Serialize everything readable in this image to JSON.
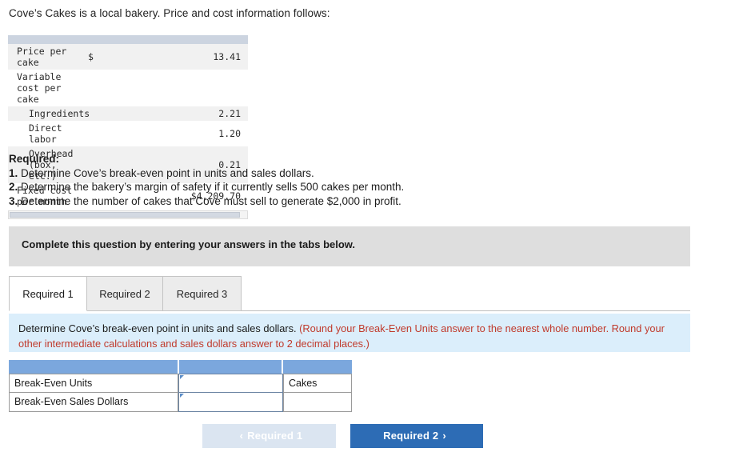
{
  "intro": "Cove’s Cakes is a local bakery. Price and cost information follows:",
  "fact_table": {
    "rows": [
      {
        "label": "Price per cake",
        "indent": false,
        "currency": "$",
        "value": "13.41",
        "shaded": true
      },
      {
        "label": "Variable cost per cake",
        "indent": false,
        "currency": "",
        "value": "",
        "shaded": false
      },
      {
        "label": "Ingredients",
        "indent": true,
        "currency": "",
        "value": "2.21",
        "shaded": true
      },
      {
        "label": "Direct labor",
        "indent": true,
        "currency": "",
        "value": "1.20",
        "shaded": false
      },
      {
        "label": "Overhead (box, etc.)",
        "indent": true,
        "currency": "",
        "value": "0.21",
        "shaded": true
      },
      {
        "label": "Fixed cost per month",
        "indent": false,
        "currency": "",
        "value": "$4,209.70",
        "shaded": false
      }
    ]
  },
  "required": {
    "heading": "Required:",
    "items": [
      {
        "num": "1.",
        "text": "Determine Cove’s break-even point in units and sales dollars."
      },
      {
        "num": "2.",
        "text": "Determine the bakery’s margin of safety if it currently sells 500 cakes per month."
      },
      {
        "num": "3.",
        "text": "Determine the number of cakes that Cove must sell to generate $2,000 in profit."
      }
    ]
  },
  "banner": {
    "text": "Complete this question by entering your answers in the tabs below."
  },
  "tabs": [
    {
      "label": "Required 1",
      "active": true
    },
    {
      "label": "Required 2",
      "active": false
    },
    {
      "label": "Required 3",
      "active": false
    }
  ],
  "instruction": {
    "black": "Determine Cove’s break-even point in units and sales dollars.",
    "red": "(Round your Break-Even Units answer to the nearest whole number. Round your other intermediate calculations and sales dollars answer to 2 decimal places.)"
  },
  "answer_table": {
    "header_cells": [
      "",
      "",
      ""
    ],
    "rows": [
      {
        "label": "Break-Even Units",
        "value": "",
        "unit": "Cakes"
      },
      {
        "label": "Break-Even Sales Dollars",
        "value": "",
        "unit": ""
      }
    ]
  },
  "nav": {
    "prev_label": "Required 1",
    "prev_chevron": "‹",
    "next_label": "Required 2",
    "next_chevron": "›"
  },
  "colors": {
    "header_blue": "#7ba7dd",
    "panel_blue": "#dbeefb",
    "banner_gray": "#dedede",
    "button_blue": "#2d6cb5",
    "button_disabled": "#dbe5f1",
    "red_text": "#c0392b"
  }
}
